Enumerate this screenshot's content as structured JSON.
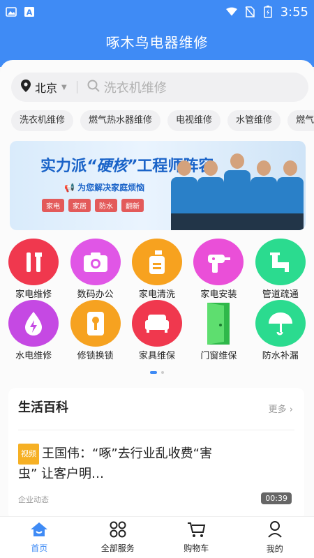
{
  "status": {
    "time": "3:55",
    "icons": [
      "image-notification-icon",
      "text-notification-icon",
      "wifi-icon",
      "no-sim-icon",
      "battery-icon"
    ]
  },
  "app": {
    "title": "啄木鸟电器维修"
  },
  "colors": {
    "accent": "#3f8bf5",
    "banner_text": "#1a63c8",
    "badge": "#f6b024"
  },
  "search": {
    "city": "北京",
    "placeholder": "洗衣机维修"
  },
  "chips": [
    "洗衣机维修",
    "燃气热水器维修",
    "电视维修",
    "水管维修",
    "燃气灶"
  ],
  "banner": {
    "headline_part1": "实力派",
    "headline_quote": "“硬核”",
    "headline_part2": "工程师阵容",
    "sub": "为您解决家庭烦恼",
    "tags": [
      "家电",
      "家居",
      "防水",
      "翻新"
    ]
  },
  "services_row1": [
    {
      "label": "家电维修",
      "icon": "wrench-screwdriver-icon",
      "color": "#f0384e"
    },
    {
      "label": "数码办公",
      "icon": "camera-icon",
      "color": "#e056e6"
    },
    {
      "label": "家电清洗",
      "icon": "spray-bottle-icon",
      "color": "#f7a21f"
    },
    {
      "label": "家电安装",
      "icon": "drill-icon",
      "color": "#ea4fd8"
    },
    {
      "label": "管道疏通",
      "icon": "pipe-icon",
      "color": "#2bdb8f"
    }
  ],
  "services_row2": [
    {
      "label": "水电维修",
      "icon": "water-drop-bolt-icon",
      "color": "#c549e3"
    },
    {
      "label": "修锁换锁",
      "icon": "lock-key-icon",
      "color": "#f6a220"
    },
    {
      "label": "家具维保",
      "icon": "sofa-icon",
      "color": "#f0384e"
    },
    {
      "label": "门窗维保",
      "icon": "door-icon",
      "color": "#3ec65c"
    },
    {
      "label": "防水补漏",
      "icon": "umbrella-icon",
      "color": "#2bdb8f"
    }
  ],
  "article_section": {
    "title": "生活百科",
    "more": "更多",
    "badge": "视频",
    "headline": "王国伟：“啄”去行业乱收费“害虫” 让客户明…",
    "source": "企业动态",
    "duration": "00:39"
  },
  "tabs": [
    {
      "label": "首页",
      "icon": "home-icon",
      "active": true
    },
    {
      "label": "全部服务",
      "icon": "grid-services-icon"
    },
    {
      "label": "购物车",
      "icon": "cart-icon"
    },
    {
      "label": "我的",
      "icon": "profile-icon"
    }
  ]
}
